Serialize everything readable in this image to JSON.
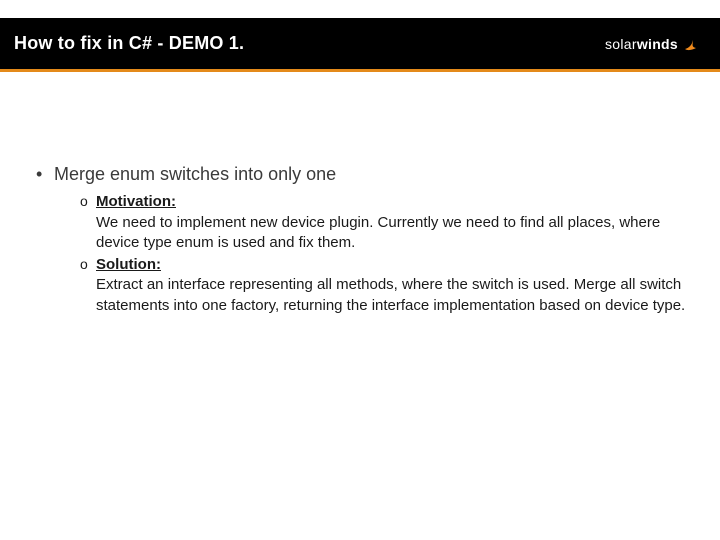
{
  "slide": {
    "title": "How to fix in C# - DEMO 1.",
    "brand": {
      "name_light": "solar",
      "name_heavy": "winds",
      "accent": "#f08b1d"
    },
    "bullets": [
      {
        "text": "Merge enum switches into only one",
        "children": [
          {
            "heading": "Motivation",
            "body": "We need to implement new device plugin. Currently we need to find all places, where device type enum is used and fix them."
          },
          {
            "heading": "Solution",
            "body": "Extract an interface representing all methods, where the switch is used. Merge all switch statements into one factory, returning the interface implementation based on device type."
          }
        ]
      }
    ]
  }
}
